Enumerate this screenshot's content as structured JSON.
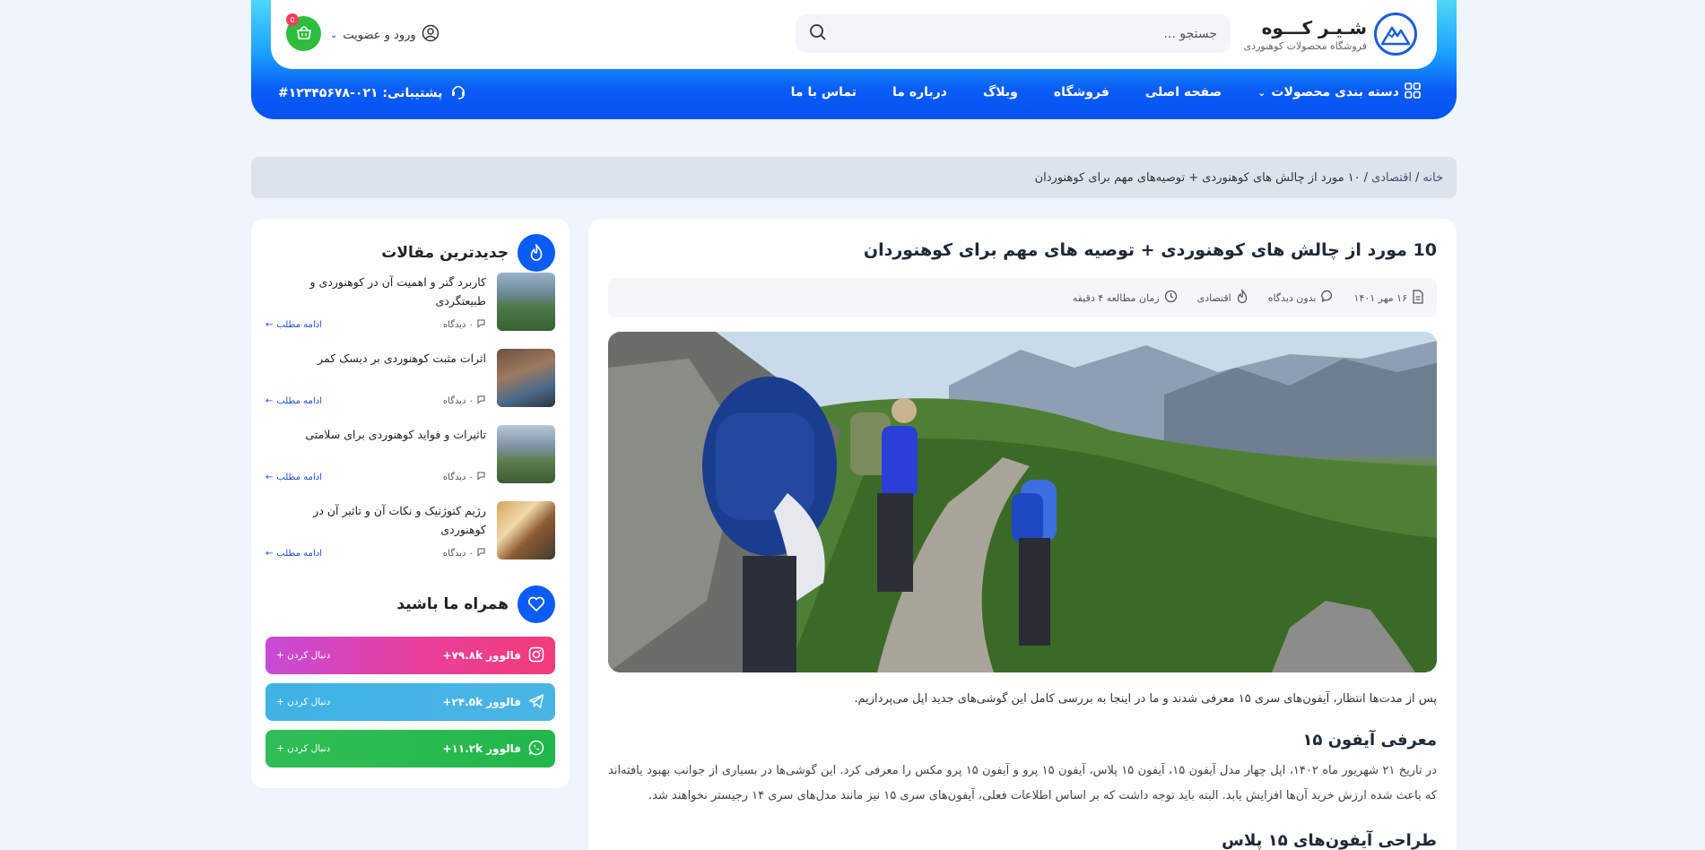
{
  "brand": {
    "name": "شـیـر کـــوه",
    "tagline": "فروشگاه محصولات کوهنوردی",
    "accent": "#0a5cf5"
  },
  "search": {
    "placeholder": "جستجو ..."
  },
  "header": {
    "login_label": "ورود و عضویت",
    "cart_count": "0",
    "support_label": "پشتیبانی: ۰۲۱-۱۲۳۴۵۶۷۸#"
  },
  "nav": {
    "items": [
      {
        "label": "دسته بندی محصولات"
      },
      {
        "label": "صفحه اصلی"
      },
      {
        "label": "فروشگاه"
      },
      {
        "label": "وبلاگ"
      },
      {
        "label": "درباره ما"
      },
      {
        "label": "تماس با ما"
      }
    ]
  },
  "breadcrumb": {
    "home": "خانه",
    "sep": "/",
    "category": "اقتصادی",
    "current": "۱۰ مورد از چالش های کوهنوردی + توصیه‌های مهم برای کوهنوردان"
  },
  "post": {
    "title": "10 مورد از چالش های کوهنوردی + توصیه های مهم برای کوهنوردان",
    "date": "۱۶ مهر ۱۴۰۱",
    "comments": "بدون دیدگاه",
    "category": "اقتصادی",
    "read_time": "زمان مطالعه ۴ دقیقه",
    "intro": "پس از مدت‌ها انتظار، آیفون‌های سری ۱۵ معرفی شدند و ما در اینجا به بررسی کامل این گوشی‌های جدید اپل می‌پردازیم.",
    "h2": "معرفی آیفون ۱۵",
    "para": "در تاریخ ۲۱ شهریور ماه ۱۴۰۲، اپل چهار مدل آیفون ۱۵، آیفون ۱۵ پلاس، آیفون ۱۵ پرو و آیفون ۱۵ پرو مکس را معرفی کرد. این گوشی‌ها در بسیاری از جوانب بهبود یافته‌اند که باعث شده ارزش خرید آن‌ها افزایش یابد. البته باید توجه داشت که بر اساس اطلاعات فعلی، آیفون‌های سری ۱۵ نیز مانند مدل‌های سری ۱۴ رجیستر نخواهند شد.",
    "h2b": "طراحی آیفون‌های ۱۵ پلاس"
  },
  "sidebar": {
    "latest_title": "جدیدترین مقالات",
    "articles": [
      {
        "title": "کاربرد گتر و اهمیت آن در کوهنوردی و طبیعتگردی",
        "comments": "۰ دیدگاه",
        "more": "ادامه مطلب"
      },
      {
        "title": "اثرات مثبت کوهنوردی بر دیسک کمر",
        "comments": "۰ دیدگاه",
        "more": "ادامه مطلب"
      },
      {
        "title": "تاثیرات و فواید کوهنوردی برای سلامتی",
        "comments": "۰ دیدگاه",
        "more": "ادامه مطلب"
      },
      {
        "title": "رژیم کتوژنیک و نکات آن و تاثیر آن در کوهنوردی",
        "comments": "۰ دیدگاه",
        "more": "ادامه مطلب"
      }
    ],
    "follow_title": "همراه ما باشید",
    "social": [
      {
        "network": "instagram",
        "followers": "فالوور ۷۹.۸k+",
        "action": "دنبال کردن +"
      },
      {
        "network": "telegram",
        "followers": "فالوور ۲۴.۵k+",
        "action": "دنبال کردن +"
      },
      {
        "network": "whatsapp",
        "followers": "فالوور ۱۱.۲k+",
        "action": "دنبال کردن +"
      }
    ]
  }
}
